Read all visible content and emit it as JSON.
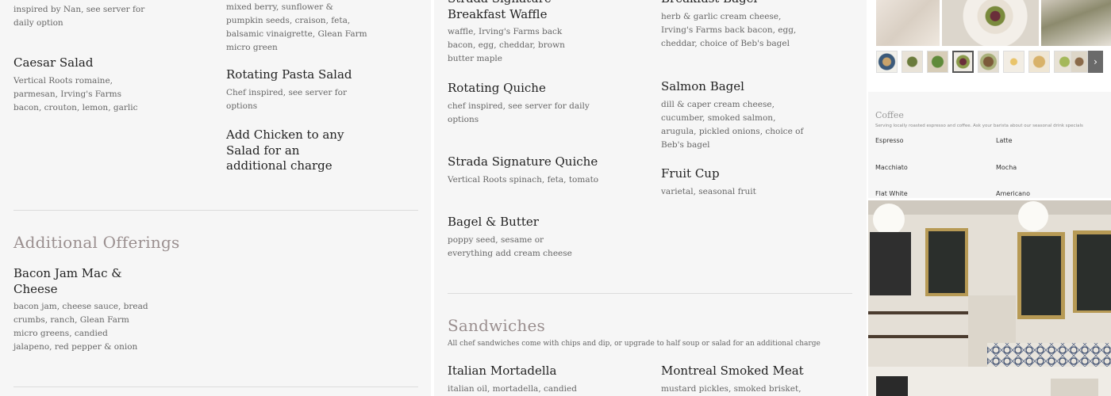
{
  "left": {
    "house_salad_desc_tail": "inspired by Nan, see server for daily option",
    "berry_salad_desc_tail": "mixed berry, sunflower & pumpkin seeds, craison, feta, balsamic vinaigrette, Glean Farm micro green",
    "caesar": {
      "name": "Caesar Salad",
      "desc": "Vertical Roots romaine, parmesan, Irving's Farms bacon, crouton, lemon, garlic"
    },
    "pasta_salad": {
      "name": "Rotating Pasta Salad",
      "desc": "Chef inspired, see server for options"
    },
    "add_chicken": {
      "name": "Add Chicken to any Salad for an additional charge"
    },
    "additional_offerings_title": "Additional Offerings",
    "mac": {
      "name": "Bacon Jam Mac & Cheese",
      "desc": "bacon jam, cheese sauce, bread crumbs, ranch, Glean Farm micro greens, candied jalapeno, red pepper & onion"
    }
  },
  "middle": {
    "waffle": {
      "name": "Strada Signature Breakfast Waffle",
      "desc": "waffle, Irving's Farms back bacon, egg, cheddar, brown butter maple"
    },
    "breakfast_bagel": {
      "name": "Breakfast Bagel",
      "desc": "herb & garlic cream cheese, Irving's Farms back bacon, egg, cheddar, choice of Beb's bagel"
    },
    "rotating_quiche": {
      "name": "Rotating Quiche",
      "desc": "chef inspired, see server for daily options"
    },
    "salmon_bagel": {
      "name": "Salmon Bagel",
      "desc": "dill & caper cream cheese, cucumber, smoked salmon, arugula, pickled onions, choice of Beb's bagel"
    },
    "signature_quiche": {
      "name": "Strada Signature Quiche",
      "desc": "Vertical Roots spinach, feta, tomato"
    },
    "fruit_cup": {
      "name": "Fruit Cup",
      "desc": "varietal, seasonal fruit"
    },
    "bagel_butter": {
      "name": "Bagel & Butter",
      "desc": "poppy seed, sesame or everything add cream cheese"
    },
    "sandwiches_title": "Sandwiches",
    "sandwiches_sub": "All chef sandwiches come with chips and dip, or upgrade to half soup or salad for an additional charge",
    "italian": {
      "name": "Italian Mortadella",
      "desc": "italian oil, mortadella, candied"
    },
    "montreal": {
      "name": "Montreal Smoked Meat",
      "desc": "mustard pickles, smoked brisket,"
    }
  },
  "right": {
    "next_arrow": "›",
    "coffee": {
      "title": "Coffee",
      "subtitle": "Serving locally roasted espresso and coffee. Ask your barista about our seasonal drink specials",
      "items": [
        "Espresso",
        "Latte",
        "Macchiato",
        "Mocha",
        "Flat White",
        "Americano"
      ]
    }
  },
  "colors": {
    "page_bg": "#f6f6f6",
    "section_title": "#9a8f8f",
    "divider": "#dcdcdc"
  },
  "icons": {
    "gallery_next": "chevron-right-icon"
  }
}
